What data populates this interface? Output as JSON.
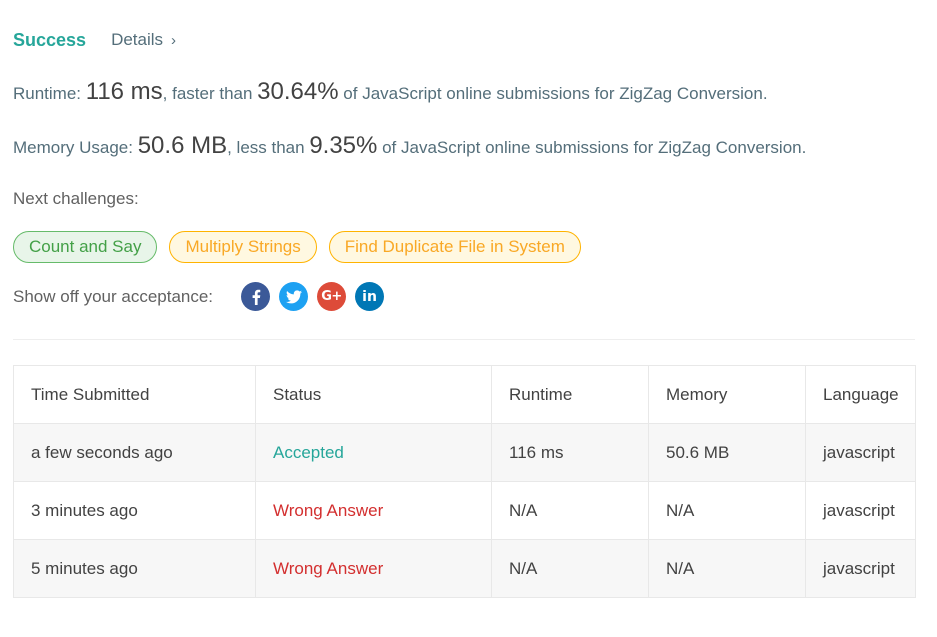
{
  "header": {
    "status": "Success",
    "details_label": "Details",
    "chevron": "›"
  },
  "runtime": {
    "label": "Runtime: ",
    "value": "116 ms",
    "mid": ", faster than ",
    "percent": "30.64%",
    "suffix": " of JavaScript online submissions for ZigZag Conversion."
  },
  "memory": {
    "label": "Memory Usage: ",
    "value": "50.6 MB",
    "mid": ", less than ",
    "percent": "9.35%",
    "suffix": " of JavaScript online submissions for ZigZag Conversion."
  },
  "next_challenges": {
    "label": "Next challenges:",
    "items": [
      {
        "label": "Count and Say",
        "difficulty_color": "#43a047"
      },
      {
        "label": "Multiply Strings",
        "difficulty_color": "#f9a825"
      },
      {
        "label": "Find Duplicate File in System",
        "difficulty_color": "#f9a825"
      }
    ]
  },
  "share": {
    "label": "Show off your acceptance:",
    "icons": [
      "facebook-icon",
      "twitter-icon",
      "google-plus-icon",
      "linkedin-icon"
    ],
    "google_plus_text": "G+",
    "linkedin_text": "in"
  },
  "colors": {
    "accent": "#26a69a",
    "wrong": "#d32f2f",
    "facebook": "#3b5998",
    "twitter": "#1da1f2",
    "google_plus": "#dd4b39",
    "linkedin": "#0077b5"
  },
  "table": {
    "columns": [
      "Time Submitted",
      "Status",
      "Runtime",
      "Memory",
      "Language"
    ],
    "rows": [
      [
        "a few seconds ago",
        "Accepted",
        "116 ms",
        "50.6 MB",
        "javascript"
      ],
      [
        "3 minutes ago",
        "Wrong Answer",
        "N/A",
        "N/A",
        "javascript"
      ],
      [
        "5 minutes ago",
        "Wrong Answer",
        "N/A",
        "N/A",
        "javascript"
      ]
    ]
  }
}
